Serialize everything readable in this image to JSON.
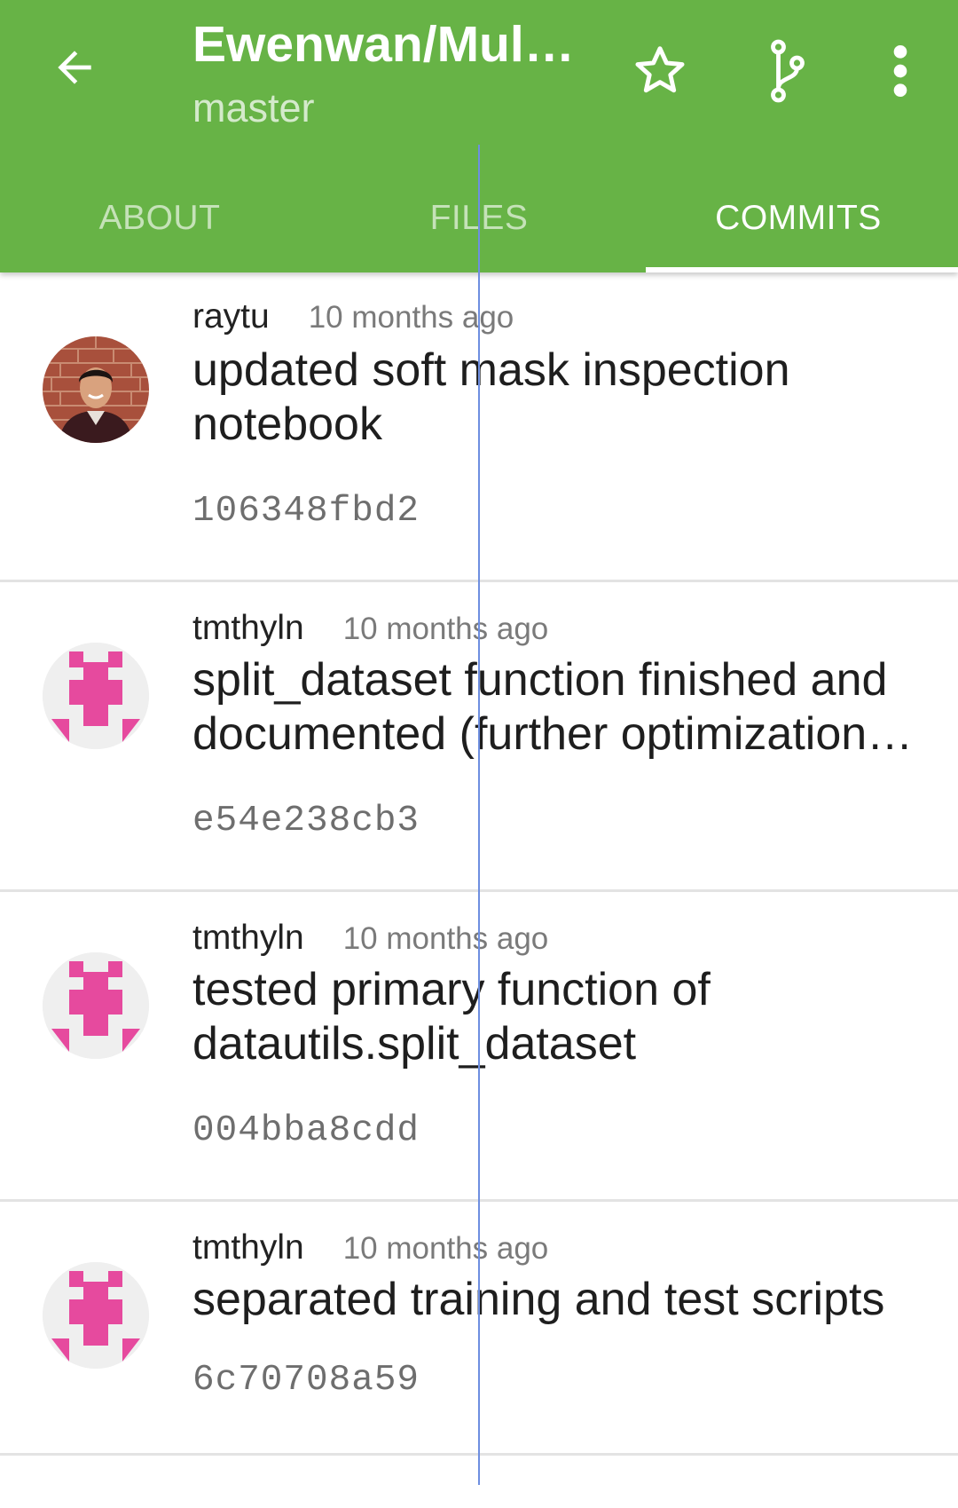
{
  "app_bar": {
    "title": "Ewenwan/MultiTaskNet",
    "subtitle": "master",
    "back_icon": "arrow-back-icon",
    "star_icon": "star-outline-icon",
    "branch_icon": "git-branch-icon",
    "more_icon": "more-vert-icon"
  },
  "tabs": [
    {
      "label": "ABOUT",
      "active": false
    },
    {
      "label": "FILES",
      "active": false
    },
    {
      "label": "COMMITS",
      "active": true
    }
  ],
  "colors": {
    "primary": "#67b346",
    "identicon_pink": "#e64a9e",
    "identicon_bg": "#efefef"
  },
  "commits": [
    {
      "author": "raytu",
      "time": "10 months ago",
      "message": "updated soft mask inspection notebook",
      "sha": "106348fbd2",
      "avatar": "photo"
    },
    {
      "author": "tmthyln",
      "time": "10 months ago",
      "message": "split_dataset function finished and documented (further optimization possible)",
      "sha": "e54e238cb3",
      "avatar": "identicon"
    },
    {
      "author": "tmthyln",
      "time": "10 months ago",
      "message": "tested primary function of datautils.split_dataset",
      "sha": "004bba8cdd",
      "avatar": "identicon"
    },
    {
      "author": "tmthyln",
      "time": "10 months ago",
      "message": "separated training and test scripts",
      "sha": "6c70708a59",
      "avatar": "identicon"
    }
  ]
}
